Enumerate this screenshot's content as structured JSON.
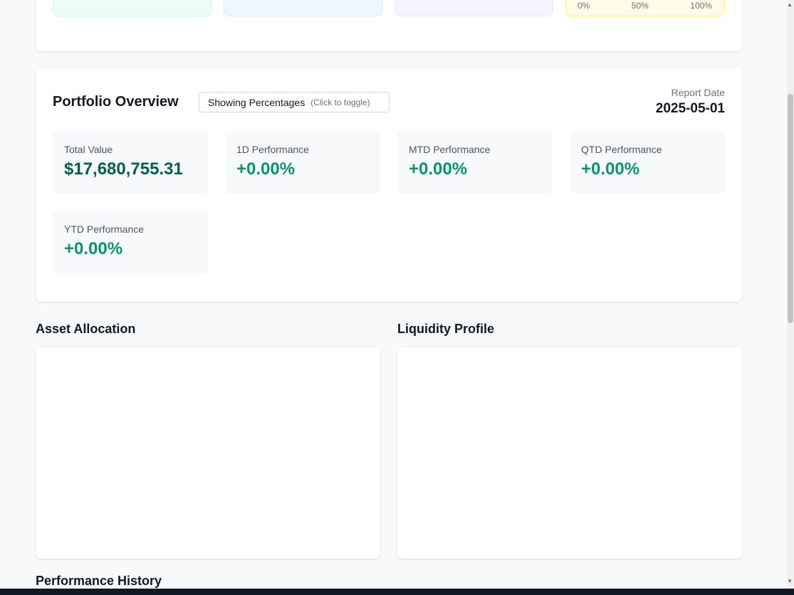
{
  "top_cards": [
    {
      "color": "#ecfdf5",
      "border": "#d1fae5"
    },
    {
      "color": "#eff6ff",
      "border": "#dbeafe"
    },
    {
      "color": "#f5f3ff",
      "border": "#ede9fe"
    },
    {
      "color": "#fefce8",
      "border": "#fef08a",
      "ticks": [
        "0%",
        "50%",
        "100%"
      ]
    }
  ],
  "portfolio": {
    "title": "Portfolio Overview",
    "toggle_label": "Showing Percentages",
    "toggle_hint": "(Click to toggle)",
    "report_date_label": "Report Date",
    "report_date": "2025-05-01",
    "metrics": [
      {
        "label": "Total Value",
        "value": "$17,680,755.31"
      },
      {
        "label": "1D Performance",
        "value": "+0.00%"
      },
      {
        "label": "MTD Performance",
        "value": "+0.00%"
      },
      {
        "label": "QTD Performance",
        "value": "+0.00%"
      },
      {
        "label": "YTD Performance",
        "value": "+0.00%"
      }
    ]
  },
  "sections": {
    "asset_allocation": "Asset Allocation",
    "liquidity_profile": "Liquidity Profile",
    "performance_history": "Performance History"
  }
}
